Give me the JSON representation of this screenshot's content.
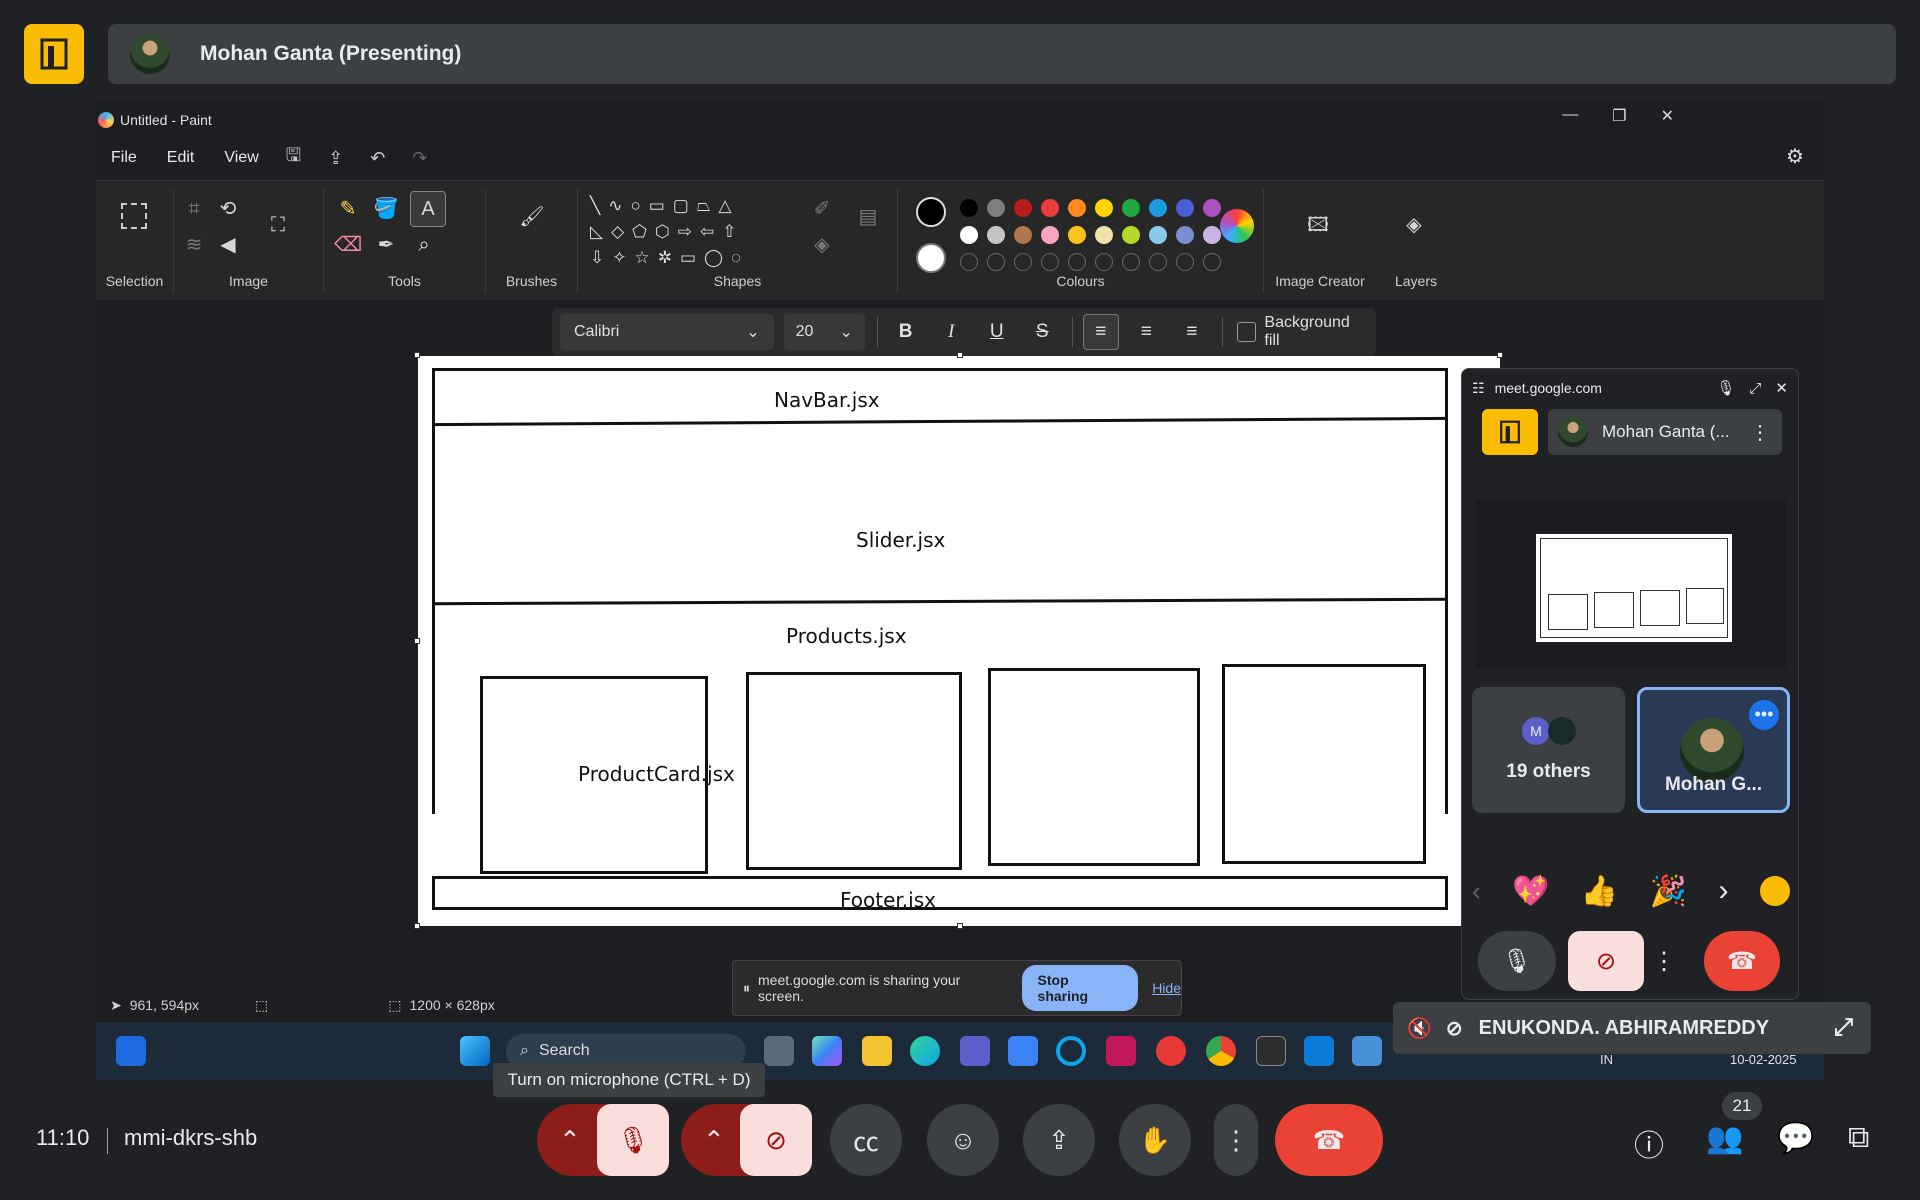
{
  "presenter": {
    "name": "Mohan Ganta (Presenting)"
  },
  "paint": {
    "title": "Untitled - Paint",
    "menu": [
      "File",
      "Edit",
      "View"
    ],
    "groups": {
      "selection": "Selection",
      "image": "Image",
      "tools": "Tools",
      "brushes": "Brushes",
      "shapes": "Shapes",
      "colours": "Colours",
      "image_creator": "Image Creator",
      "layers": "Layers"
    },
    "text_toolbar": {
      "font": "Calibri",
      "size": "20",
      "background_fill": "Background fill"
    },
    "canvas_labels": {
      "navbar": "NavBar.jsx",
      "slider": "Slider.jsx",
      "products": "Products.jsx",
      "productcard": "ProductCard.jsx",
      "footer": "Footer.jsx"
    },
    "status": {
      "cursor": "961, 594px",
      "size": "1200 × 628px"
    },
    "palette": {
      "row1": [
        "#000000",
        "#7f7f7f",
        "#b91c1c",
        "#ee3b3b",
        "#ff8a1f",
        "#ffd400",
        "#22a845",
        "#1e9be0",
        "#4a5fd8",
        "#b04fc4"
      ],
      "row2": [
        "#ffffff",
        "#c4c4c4",
        "#b0764f",
        "#f5a6c0",
        "#ffc21a",
        "#eee2a8",
        "#b5d92a",
        "#87cbe8",
        "#7a8fd0",
        "#c7b4e3"
      ]
    }
  },
  "share_notice": {
    "text": "meet.google.com is sharing your screen.",
    "stop": "Stop sharing",
    "hide": "Hide"
  },
  "taskbar": {
    "search": "Search",
    "lang": "IN",
    "date": "10-02-2025"
  },
  "pip": {
    "host": "meet.google.com",
    "presenter_short": "Mohan Ganta (...",
    "others_avatar": "M",
    "others": "19 others",
    "self_name": "Mohan G...",
    "reactions": [
      "💖",
      "👍",
      "🎉"
    ]
  },
  "tile_name": "ENUKONDA. ABHIRAMREDDY",
  "tooltip": "Turn on microphone (CTRL + D)",
  "meeting": {
    "time": "11:10",
    "code": "mmi-dkrs-shb",
    "participants_count": "21"
  }
}
